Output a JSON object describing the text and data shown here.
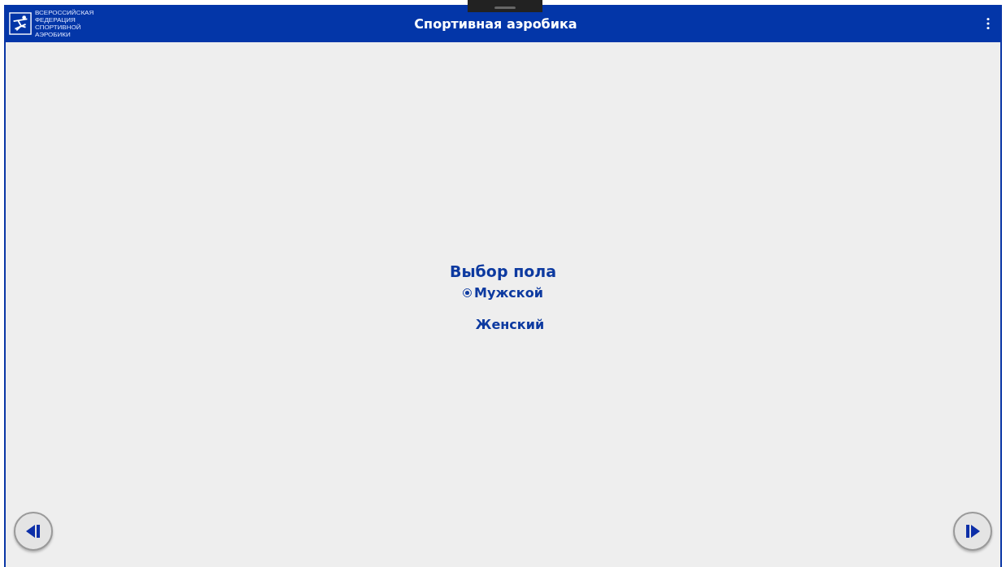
{
  "header": {
    "logo_lines": [
      "ВСЕРОССИЙСКАЯ",
      "ФЕДЕРАЦИЯ",
      "СПОРТИВНОЙ",
      "АЭРОБИКИ"
    ],
    "title": "Спортивная аэробика"
  },
  "gender_choice": {
    "heading": "Выбор пола",
    "options": [
      {
        "label": "Мужской",
        "selected": true
      },
      {
        "label": "Женский",
        "selected": false
      }
    ]
  }
}
